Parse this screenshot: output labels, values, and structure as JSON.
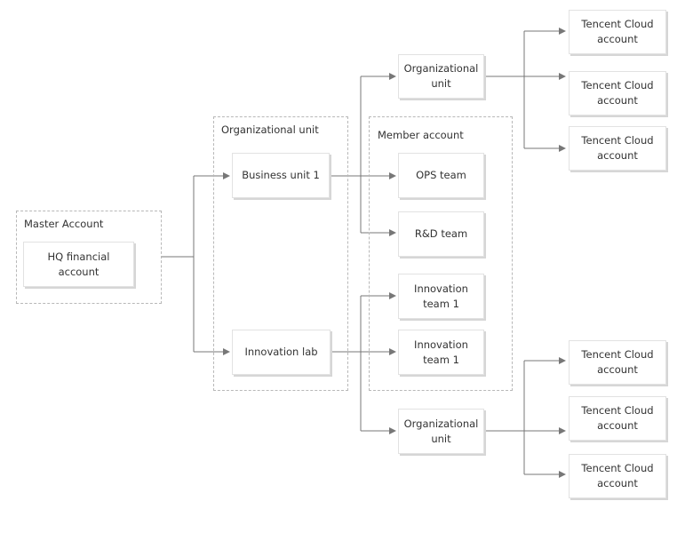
{
  "groups": {
    "master": "Master Account",
    "org_unit": "Organizational unit",
    "member": "Member account"
  },
  "nodes": {
    "hq": "HQ financial account",
    "business_unit": "Business unit 1",
    "innovation_lab": "Innovation lab",
    "org_unit_top": "Organizational unit",
    "ops_team": "OPS team",
    "rd_team": "R&D team",
    "innovation_team_a": "Innovation team 1",
    "innovation_team_b": "Innovation team 1",
    "org_unit_bottom": "Organizational unit",
    "cloud_top": [
      "Tencent Cloud account",
      "Tencent Cloud account",
      "Tencent Cloud account"
    ],
    "cloud_bottom": [
      "Tencent Cloud account",
      "Tencent Cloud account",
      "Tencent Cloud account"
    ]
  },
  "colors": {
    "line": "#777777",
    "dashed_border": "#b8b8b8",
    "text": "#333333"
  }
}
